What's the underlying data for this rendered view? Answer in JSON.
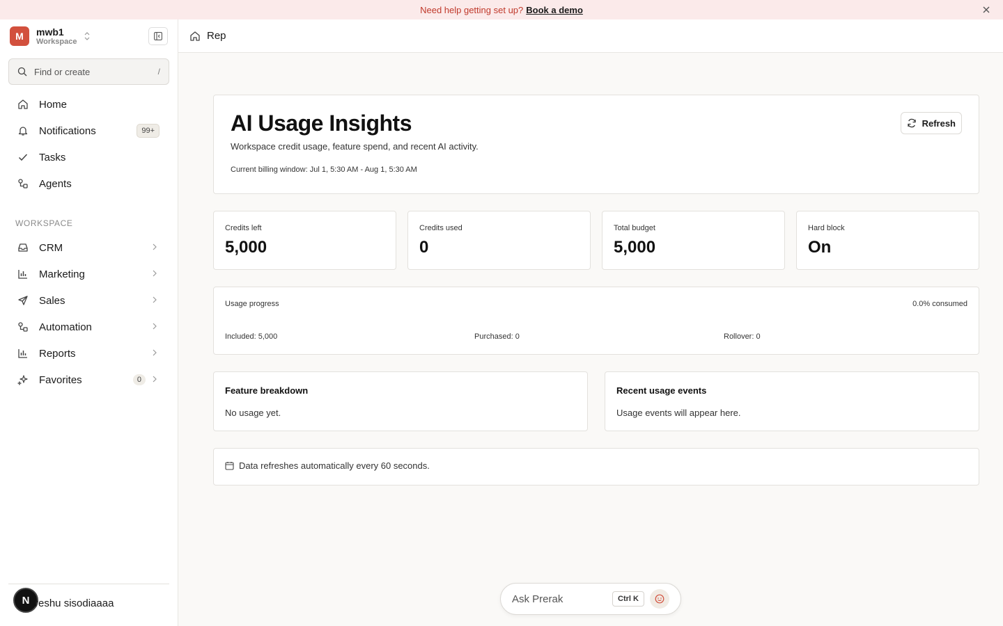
{
  "banner": {
    "text": "Need help getting set up?",
    "link": "Book a demo"
  },
  "workspace": {
    "initial": "M",
    "name": "mwb1",
    "type": "Workspace"
  },
  "search": {
    "placeholder": "Find or create",
    "shortcut": "/"
  },
  "nav": {
    "home": "Home",
    "notifications": "Notifications",
    "notifications_badge": "99+",
    "tasks": "Tasks",
    "agents": "Agents"
  },
  "workspace_section": {
    "label": "WORKSPACE",
    "crm": "CRM",
    "marketing": "Marketing",
    "sales": "Sales",
    "automation": "Automation",
    "reports": "Reports",
    "favorites": "Favorites",
    "favorites_count": "0"
  },
  "user": {
    "initial": "N",
    "name": "reshu sisodiaaaa"
  },
  "topbar": {
    "title": "Rep"
  },
  "hero": {
    "title": "AI Usage Insights",
    "subtitle": "Workspace credit usage, feature spend, and recent AI activity.",
    "billing_window": "Current billing window: Jul 1, 5:30 AM - Aug 1, 5:30 AM",
    "refresh_label": "Refresh"
  },
  "stats": {
    "credits_left_label": "Credits left",
    "credits_left_value": "5,000",
    "credits_used_label": "Credits used",
    "credits_used_value": "0",
    "total_budget_label": "Total budget",
    "total_budget_value": "5,000",
    "hard_block_label": "Hard block",
    "hard_block_value": "On"
  },
  "usage": {
    "label": "Usage progress",
    "consumed": "0.0% consumed",
    "consumed_fraction": 0.0,
    "included": "Included: 5,000",
    "purchased": "Purchased: 0",
    "rollover": "Rollover: 0"
  },
  "feature_breakdown": {
    "title": "Feature breakdown",
    "body": "No usage yet."
  },
  "recent_events": {
    "title": "Recent usage events",
    "body": "Usage events will appear here."
  },
  "footer_note": {
    "text": "Data refreshes automatically every 60 seconds."
  },
  "ask": {
    "placeholder": "Ask Prerak",
    "shortcut": "Ctrl K"
  },
  "colors": {
    "accent": "#d2503d",
    "banner_bg": "#fbeaea",
    "banner_text": "#c0392b"
  }
}
